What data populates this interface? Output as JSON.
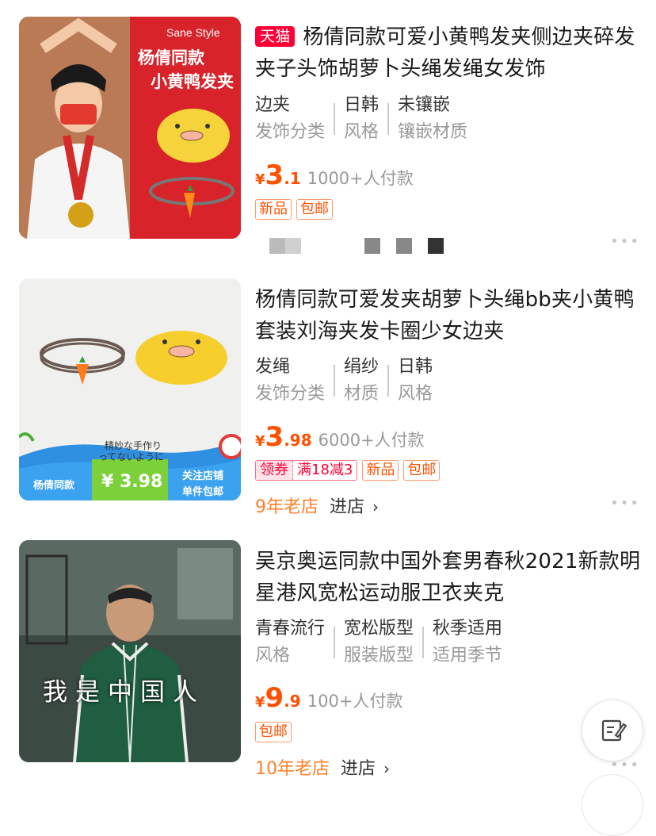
{
  "items": [
    {
      "badge": "天猫",
      "title": "杨倩同款可爱小黄鸭发夹侧边夹碎发夹子头饰胡萝卜头绳发绳女发饰",
      "attrs": [
        {
          "value": "边夹",
          "key": "发饰分类"
        },
        {
          "value": "日韩",
          "key": "风格"
        },
        {
          "value": "未镶嵌",
          "key": "镶嵌材质"
        }
      ],
      "price": {
        "symbol": "¥",
        "int": "3",
        "dec": ".1"
      },
      "sales": "1000+人付款",
      "tags": [
        "新品",
        "包邮"
      ],
      "image": {
        "brand": "Sane Style",
        "line1": "杨倩同款",
        "line2": "小黄鸭发夹"
      },
      "more": "•••"
    },
    {
      "title": "杨倩同款可爱发夹胡萝卜头绳bb夹小黄鸭套装刘海夹发卡圈少女边夹",
      "attrs": [
        {
          "value": "发绳",
          "key": "发饰分类"
        },
        {
          "value": "绢纱",
          "key": "材质"
        },
        {
          "value": "日韩",
          "key": "风格"
        }
      ],
      "price": {
        "symbol": "¥",
        "int": "3",
        "dec": ".98"
      },
      "sales": "6000+人付款",
      "coupon": {
        "label": "领券",
        "value": "满18减3"
      },
      "tags": [
        "新品",
        "包邮"
      ],
      "shop": {
        "age": "9年老店",
        "enter": "进店",
        "chevron": "›"
      },
      "image": {
        "jp1": "精妙な手作り",
        "jp2": "ってないように",
        "left": "杨倩同款",
        "price": "¥ 3.98",
        "right1": "关注店铺",
        "right2": "单件包邮"
      },
      "more": "•••"
    },
    {
      "title": "吴京奥运同款中国外套男春秋2021新款明星港风宽松运动服卫衣夹克",
      "attrs": [
        {
          "value": "青春流行",
          "key": "风格"
        },
        {
          "value": "宽松版型",
          "key": "服装版型"
        },
        {
          "value": "秋季适用",
          "key": "适用季节"
        }
      ],
      "price": {
        "symbol": "¥",
        "int": "9",
        "dec": ".9"
      },
      "sales": "100+人付款",
      "tags": [
        "包邮"
      ],
      "shop": {
        "age": "10年老店",
        "enter": "进店",
        "chevron": "›"
      },
      "image": {
        "caption": "我是中国人"
      },
      "more": "•••"
    }
  ],
  "colors": {
    "price": "#ff5000",
    "tmall": "#ff0036",
    "shop_age": "#ff7f2a"
  },
  "icons": {
    "feedback": "edit-note-icon"
  }
}
